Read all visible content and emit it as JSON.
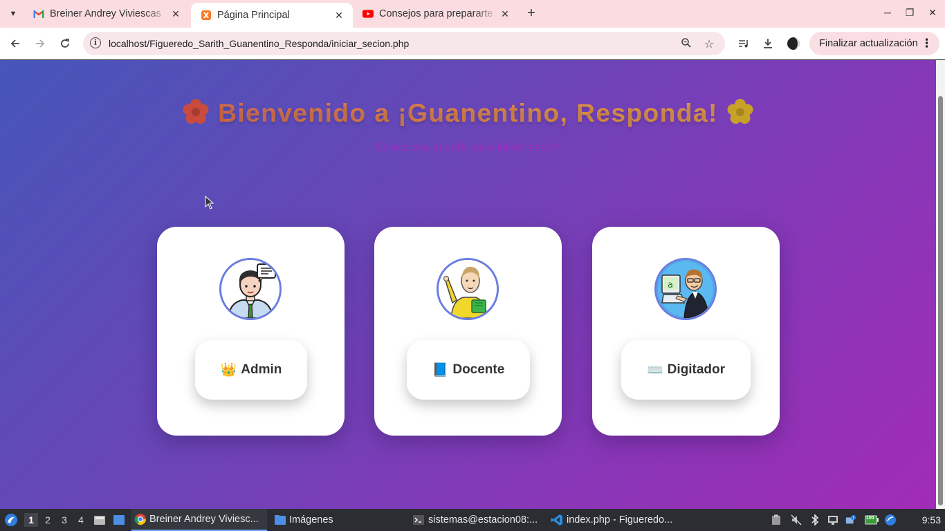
{
  "browser": {
    "tabs": [
      {
        "title": "Breiner Andrey Viviescas",
        "icon": "gmail-icon",
        "active": false
      },
      {
        "title": "Página Principal",
        "icon": "xampp-icon",
        "active": true
      },
      {
        "title": "Consejos para prepararte",
        "icon": "youtube-icon",
        "active": false
      }
    ],
    "url": "localhost/Figueredo_Sarith_Guanentino_Responda/iniciar_secion.php",
    "update_button": "Finalizar actualización"
  },
  "page": {
    "title": "Bienvenido a ¡Guanentino, Responda!",
    "subtitle": "Selecciona tu perfil para iniciar sesión",
    "roles": [
      {
        "label": "Admin",
        "emoji": "👑"
      },
      {
        "label": "Docente",
        "emoji": "📘"
      },
      {
        "label": "Digitador",
        "emoji": "⌨️"
      }
    ]
  },
  "taskbar": {
    "workspaces": [
      "1",
      "2",
      "3",
      "4"
    ],
    "windows": [
      {
        "title": "Breiner Andrey Viviesc...",
        "icon": "chrome-icon"
      },
      {
        "title": "Imágenes",
        "icon": "folder-icon"
      },
      {
        "title": "sistemas@estacion08:...",
        "icon": "terminal-icon"
      },
      {
        "title": "index.php - Figueredo...",
        "icon": "vscode-icon"
      }
    ],
    "battery_label": "100",
    "clock": "9:53"
  },
  "colors": {
    "page_gradient": [
      "#4656b8",
      "#a12cb5"
    ],
    "title_gradient": [
      "#d35a4e",
      "#e0a44a"
    ],
    "subtitle": "#9b2fbf",
    "avatar_border": "#6a7de0"
  }
}
